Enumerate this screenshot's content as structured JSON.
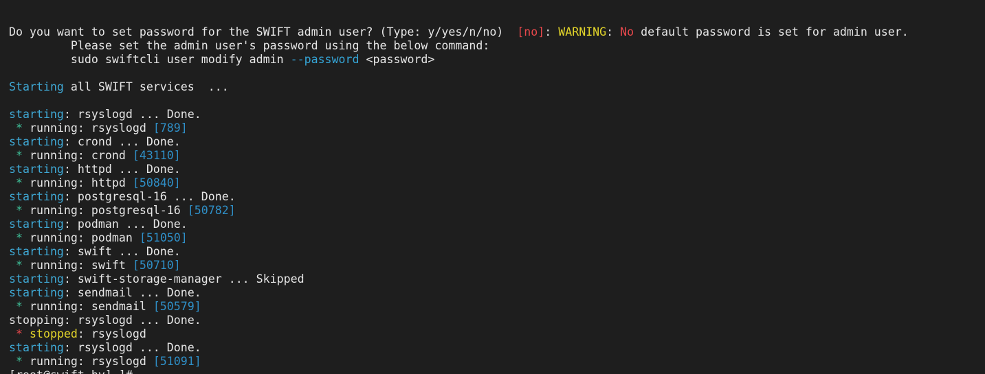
{
  "terminal": {
    "lines": [
      {
        "name": "line-password-prompt",
        "segments": [
          {
            "text": "Do you want to set password for the SWIFT admin user? (Type: y/yes/n/no)  ",
            "color": "#e6e6e6"
          },
          {
            "text": "[no]",
            "color": "#e8484c"
          },
          {
            "text": ": ",
            "color": "#e6e6e6"
          },
          {
            "text": "WARNING",
            "color": "#e2d42a"
          },
          {
            "text": ": ",
            "color": "#e6e6e6"
          },
          {
            "text": "No",
            "color": "#e8484c"
          },
          {
            "text": " default password is set for admin user.",
            "color": "#e6e6e6"
          }
        ]
      },
      {
        "name": "line-password-instruction",
        "segments": [
          {
            "text": "         Please set the admin user's password using the below command:",
            "color": "#e6e6e6"
          }
        ]
      },
      {
        "name": "line-password-command",
        "segments": [
          {
            "text": "         sudo swiftcli user modify admin ",
            "color": "#e6e6e6"
          },
          {
            "text": "--password",
            "color": "#35a6d8"
          },
          {
            "text": " <password>",
            "color": "#e6e6e6"
          }
        ]
      },
      {
        "name": "line-blank",
        "segments": [
          {
            "text": "",
            "color": "#e6e6e6"
          }
        ]
      },
      {
        "name": "line-starting-all",
        "segments": [
          {
            "text": "Starting",
            "color": "#3fa9d6"
          },
          {
            "text": " all SWIFT services  ...",
            "color": "#e6e6e6"
          }
        ]
      },
      {
        "name": "line-blank",
        "segments": [
          {
            "text": "",
            "color": "#e6e6e6"
          }
        ]
      },
      {
        "name": "line-starting-rsyslogd",
        "segments": [
          {
            "text": "starting",
            "color": "#3fa9d6"
          },
          {
            "text": ": rsyslogd ... Done.",
            "color": "#e6e6e6"
          }
        ]
      },
      {
        "name": "line-running-rsyslogd",
        "segments": [
          {
            "text": " * ",
            "color": "#3fc29a"
          },
          {
            "text": "running: rsyslogd ",
            "color": "#e6e6e6"
          },
          {
            "text": "[789]",
            "color": "#2f8fc7"
          }
        ]
      },
      {
        "name": "line-starting-crond",
        "segments": [
          {
            "text": "starting",
            "color": "#3fa9d6"
          },
          {
            "text": ": crond ... Done.",
            "color": "#e6e6e6"
          }
        ]
      },
      {
        "name": "line-running-crond",
        "segments": [
          {
            "text": " * ",
            "color": "#3fc29a"
          },
          {
            "text": "running: crond ",
            "color": "#e6e6e6"
          },
          {
            "text": "[43110]",
            "color": "#2f8fc7"
          }
        ]
      },
      {
        "name": "line-starting-httpd",
        "segments": [
          {
            "text": "starting",
            "color": "#3fa9d6"
          },
          {
            "text": ": httpd ... Done.",
            "color": "#e6e6e6"
          }
        ]
      },
      {
        "name": "line-running-httpd",
        "segments": [
          {
            "text": " * ",
            "color": "#3fc29a"
          },
          {
            "text": "running: httpd ",
            "color": "#e6e6e6"
          },
          {
            "text": "[50840]",
            "color": "#2f8fc7"
          }
        ]
      },
      {
        "name": "line-starting-postgresql",
        "segments": [
          {
            "text": "starting",
            "color": "#3fa9d6"
          },
          {
            "text": ": postgresql-16 ... Done.",
            "color": "#e6e6e6"
          }
        ]
      },
      {
        "name": "line-running-postgresql",
        "segments": [
          {
            "text": " * ",
            "color": "#3fc29a"
          },
          {
            "text": "running: postgresql-16 ",
            "color": "#e6e6e6"
          },
          {
            "text": "[50782]",
            "color": "#2f8fc7"
          }
        ]
      },
      {
        "name": "line-starting-podman",
        "segments": [
          {
            "text": "starting",
            "color": "#3fa9d6"
          },
          {
            "text": ": podman ... Done.",
            "color": "#e6e6e6"
          }
        ]
      },
      {
        "name": "line-running-podman",
        "segments": [
          {
            "text": " * ",
            "color": "#3fc29a"
          },
          {
            "text": "running: podman ",
            "color": "#e6e6e6"
          },
          {
            "text": "[51050]",
            "color": "#2f8fc7"
          }
        ]
      },
      {
        "name": "line-starting-swift",
        "segments": [
          {
            "text": "starting",
            "color": "#3fa9d6"
          },
          {
            "text": ": swift ... Done.",
            "color": "#e6e6e6"
          }
        ]
      },
      {
        "name": "line-running-swift",
        "segments": [
          {
            "text": " * ",
            "color": "#3fc29a"
          },
          {
            "text": "running: swift ",
            "color": "#e6e6e6"
          },
          {
            "text": "[50710]",
            "color": "#2f8fc7"
          }
        ]
      },
      {
        "name": "line-starting-storage-manager",
        "segments": [
          {
            "text": "starting",
            "color": "#3fa9d6"
          },
          {
            "text": ": swift-storage-manager ... Skipped",
            "color": "#e6e6e6"
          }
        ]
      },
      {
        "name": "line-starting-sendmail",
        "segments": [
          {
            "text": "starting",
            "color": "#3fa9d6"
          },
          {
            "text": ": sendmail ... Done.",
            "color": "#e6e6e6"
          }
        ]
      },
      {
        "name": "line-running-sendmail",
        "segments": [
          {
            "text": " * ",
            "color": "#3fc29a"
          },
          {
            "text": "running: sendmail ",
            "color": "#e6e6e6"
          },
          {
            "text": "[50579]",
            "color": "#2f8fc7"
          }
        ]
      },
      {
        "name": "line-stopping-rsyslogd",
        "segments": [
          {
            "text": "stopping: rsyslogd ... Done.",
            "color": "#e6e6e6"
          }
        ]
      },
      {
        "name": "line-stopped-rsyslogd",
        "segments": [
          {
            "text": " * ",
            "color": "#e8484c"
          },
          {
            "text": "stopped",
            "color": "#e2d42a"
          },
          {
            "text": ": rsyslogd",
            "color": "#e6e6e6"
          }
        ]
      },
      {
        "name": "line-restarting-rsyslogd",
        "segments": [
          {
            "text": "starting",
            "color": "#3fa9d6"
          },
          {
            "text": ": rsyslogd ... Done.",
            "color": "#e6e6e6"
          }
        ]
      },
      {
        "name": "line-running-rsyslogd-new",
        "segments": [
          {
            "text": " * ",
            "color": "#3fc29a"
          },
          {
            "text": "running: rsyslogd ",
            "color": "#e6e6e6"
          },
          {
            "text": "[51091]",
            "color": "#2f8fc7"
          }
        ]
      }
    ],
    "prompt": "[root@swift-hv]~]#"
  }
}
